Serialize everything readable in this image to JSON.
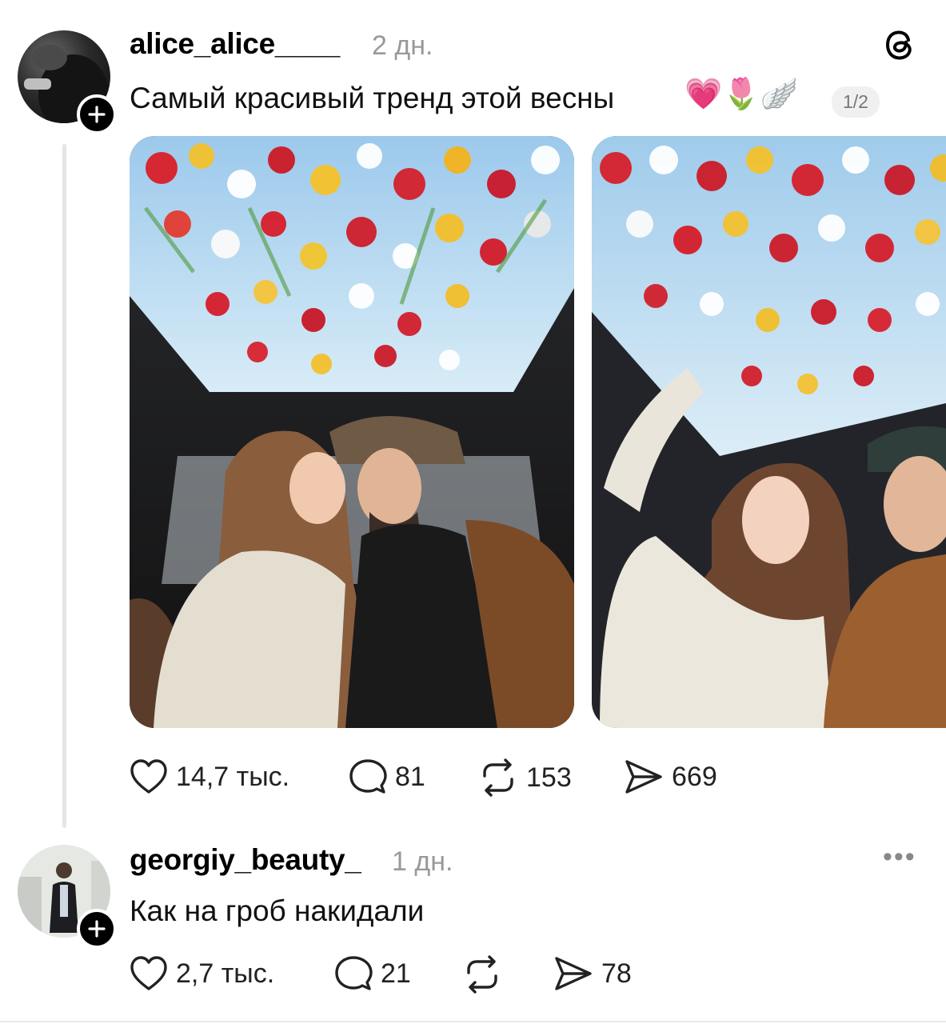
{
  "post": {
    "username": "alice_alice____",
    "time": "2 дн.",
    "text": "Самый красивый тренд этой весны",
    "emojis": "💗🌷🪽",
    "image_counter": "1/2",
    "stats": {
      "likes": "14,7 тыс.",
      "replies": "81",
      "reposts": "153",
      "shares": "669"
    }
  },
  "reply": {
    "username": "georgiy_beauty_",
    "time": "1 дн.",
    "text": "Как на гроб накидали",
    "stats": {
      "likes": "2,7 тыс.",
      "replies": "21",
      "shares": "78"
    }
  },
  "icons": {
    "brand": "threads-logo-icon",
    "follow": "plus-icon",
    "like": "heart-icon",
    "reply": "comment-icon",
    "repost": "repost-icon",
    "share": "send-icon",
    "more": "more-dots-icon"
  }
}
